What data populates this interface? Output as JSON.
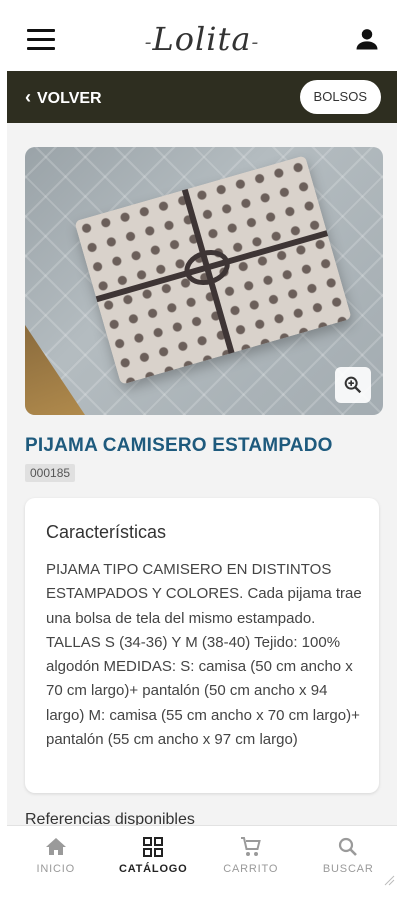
{
  "header": {
    "logo_text": "Lolita",
    "menu_icon": "hamburger-menu-icon",
    "account_icon": "user-icon"
  },
  "subheader": {
    "back_label": "VOLVER",
    "category_label": "BOLSOS"
  },
  "product": {
    "title": "PIJAMA CAMISERO ESTAMPADO",
    "sku": "000185",
    "features_heading": "Características",
    "description": "PIJAMA TIPO CAMISERO EN DISTINTOS ESTAMPADOS Y COLORES. Cada pijama trae una bolsa de tela del mismo estampado. TALLAS S (34-36) Y M (38-40) Tejido: 100% algodón MEDIDAS: S: camisa (50 cm ancho x 70 cm largo)+ pantalón (50 cm ancho x 94 largo) M: camisa (55 cm ancho x 70 cm largo)+ pantalón (55 cm ancho x 97 cm largo)",
    "references_heading": "Referencias disponibles"
  },
  "bottom_nav": {
    "items": [
      {
        "label": "INICIO",
        "icon": "home-icon"
      },
      {
        "label": "CATÁLOGO",
        "icon": "grid-icon",
        "active": true
      },
      {
        "label": "CARRITO",
        "icon": "cart-icon"
      },
      {
        "label": "BUSCAR",
        "icon": "search-icon"
      }
    ]
  },
  "colors": {
    "subheader_bg": "#2e2e20",
    "title_blue": "#1e5a7d",
    "nav_inactive": "#9a9a9a"
  }
}
